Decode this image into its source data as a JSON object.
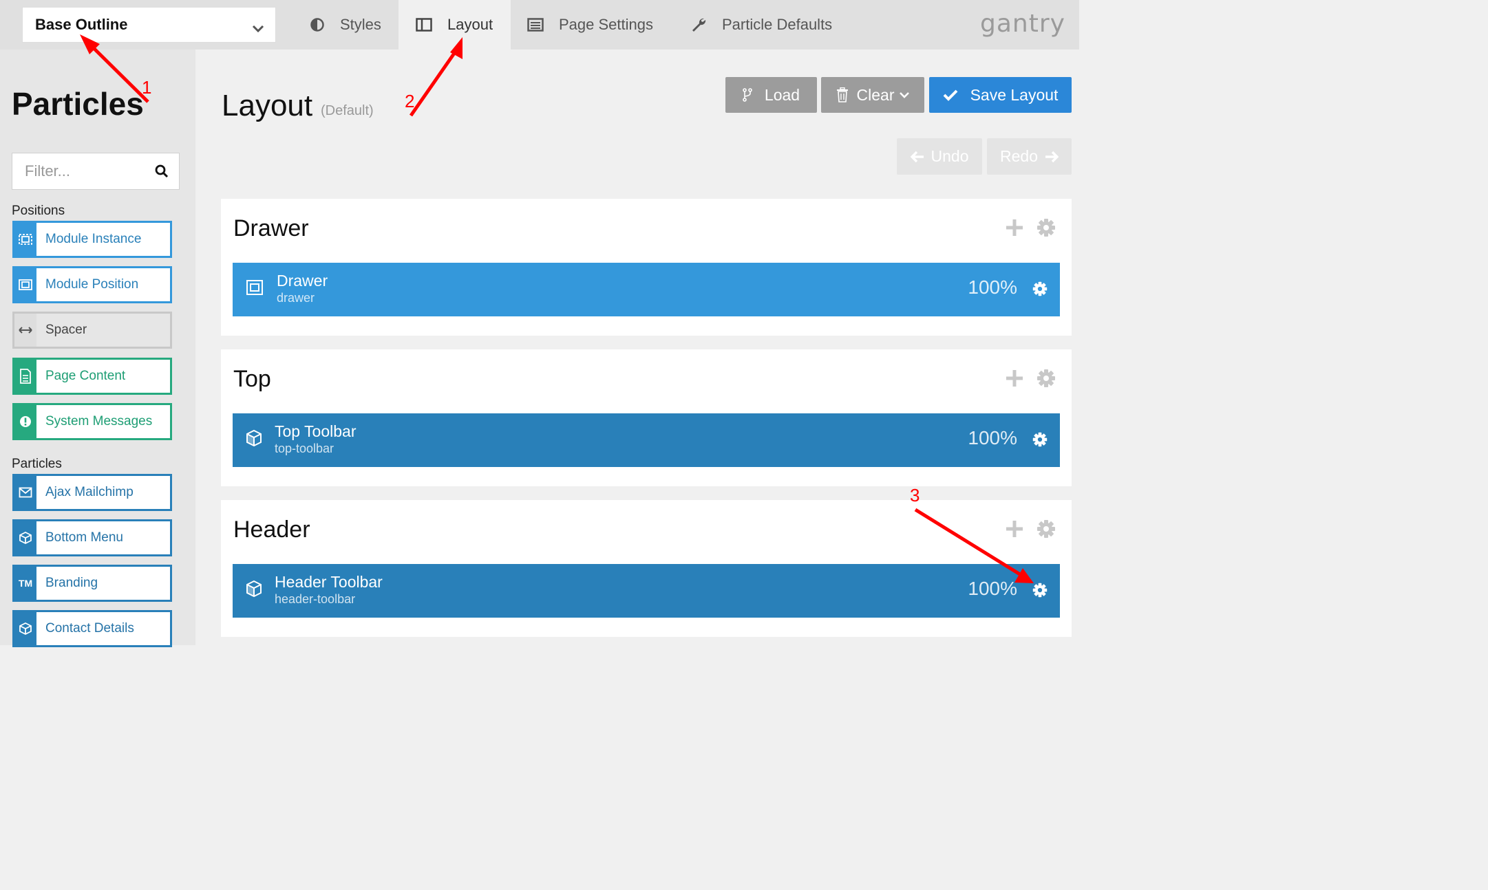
{
  "outline": {
    "selected": "Base Outline"
  },
  "nav": {
    "tabs": [
      {
        "label": "Styles",
        "icon": "contrast-icon"
      },
      {
        "label": "Layout",
        "icon": "columns-icon",
        "active": true
      },
      {
        "label": "Page Settings",
        "icon": "list-icon"
      },
      {
        "label": "Particle Defaults",
        "icon": "wrench-icon"
      }
    ],
    "logo": "gantry"
  },
  "sidebar": {
    "title": "Particles",
    "filter_placeholder": "Filter...",
    "positions_label": "Positions",
    "positions": [
      {
        "label": "Module Instance",
        "icon": "module-instance-icon",
        "color": "#3498db"
      },
      {
        "label": "Module Position",
        "icon": "module-position-icon",
        "color": "#3498db"
      },
      {
        "label": "Spacer",
        "icon": "arrows-h-icon",
        "color": "#c8c8c8"
      },
      {
        "label": "Page Content",
        "icon": "file-text-icon",
        "color": "#26a97f"
      },
      {
        "label": "System Messages",
        "icon": "exclamation-circle-icon",
        "color": "#26a97f"
      }
    ],
    "particles_label": "Particles",
    "particles": [
      {
        "label": "Ajax Mailchimp",
        "icon": "envelope-icon",
        "color": "#2980b9"
      },
      {
        "label": "Bottom Menu",
        "icon": "cube-icon",
        "color": "#2980b9"
      },
      {
        "label": "Branding",
        "icon": "trademark-icon",
        "icon_text": "TM",
        "color": "#2980b9"
      },
      {
        "label": "Contact Details",
        "icon": "cube-icon",
        "color": "#2980b9"
      }
    ]
  },
  "main": {
    "title": "Layout",
    "subtitle": "(Default)",
    "buttons": {
      "load": "Load",
      "clear": "Clear",
      "save": "Save Layout",
      "undo": "Undo",
      "redo": "Redo"
    },
    "sections": [
      {
        "title": "Drawer",
        "block": {
          "title": "Drawer",
          "sub": "drawer",
          "pct": "100%",
          "color": "#3498db"
        }
      },
      {
        "title": "Top",
        "block": {
          "title": "Top Toolbar",
          "sub": "top-toolbar",
          "pct": "100%",
          "color": "#2980b9"
        }
      },
      {
        "title": "Header",
        "block": {
          "title": "Header Toolbar",
          "sub": "header-toolbar",
          "pct": "100%",
          "color": "#2980b9"
        }
      }
    ]
  },
  "annotations": {
    "n1": "1",
    "n2": "2",
    "n3": "3",
    "color": "#ff0000"
  }
}
